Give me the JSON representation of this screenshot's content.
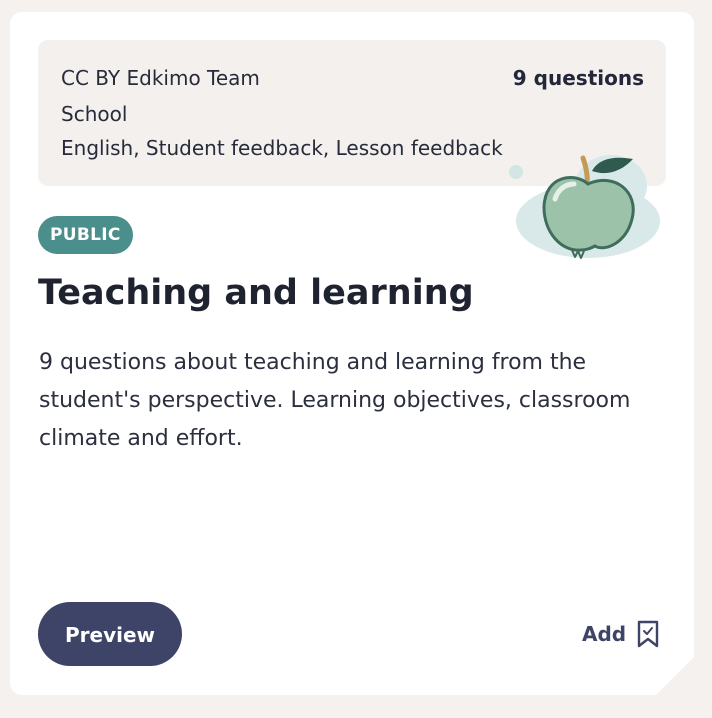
{
  "card": {
    "license_author": "CC BY Edkimo Team",
    "school_type": "School",
    "tags": "English, Student feedback, Lesson feedback",
    "question_count": "9 questions",
    "badge": "PUBLIC",
    "title": "Teaching and learning",
    "description": "9 questions about teaching and learning from the student's perspective. Learning objectives, classroom climate and effort.",
    "preview_label": "Preview",
    "add_label": "Add",
    "illustration": "apple-icon",
    "add_icon": "bookmark-check-icon"
  },
  "colors": {
    "badge": "#4a8f8b",
    "button": "#3d4468",
    "meta_background": "#f3f0ed",
    "apple": "#9cc3aa"
  }
}
